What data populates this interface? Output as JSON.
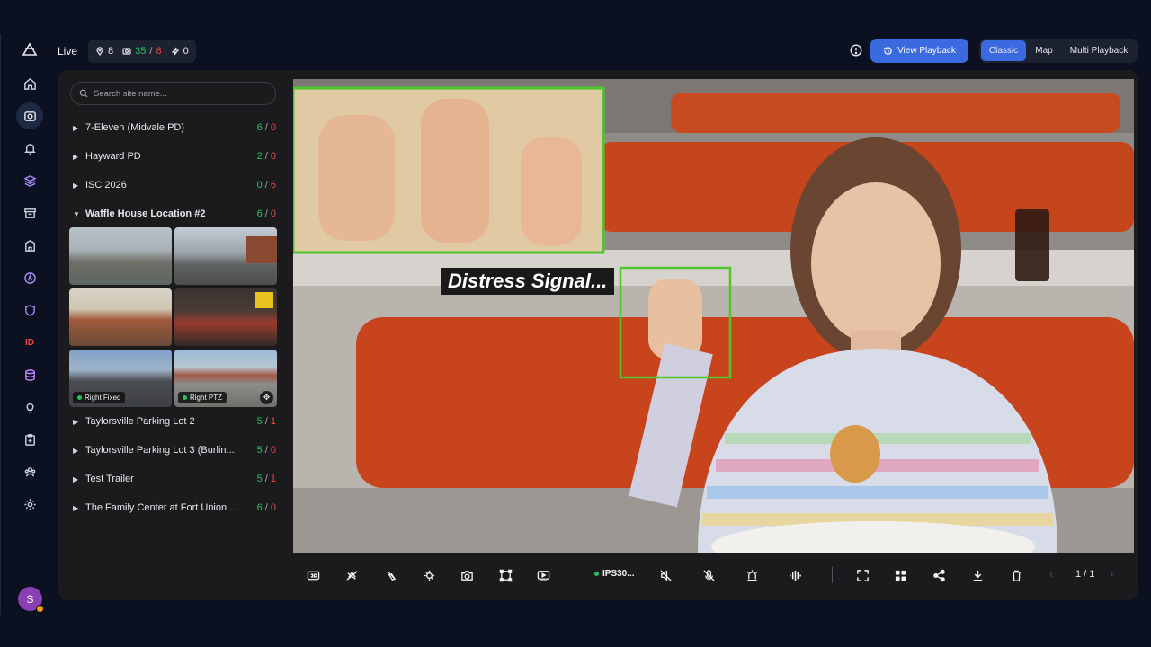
{
  "topbar": {
    "live_label": "Live",
    "stats": {
      "locations": "8",
      "online": "35",
      "offline": "8",
      "alerts": "0"
    },
    "view_playback": "View Playback",
    "modes": [
      "Classic",
      "Map",
      "Multi Playback"
    ],
    "active_mode": "Classic"
  },
  "rail": {
    "items": [
      "home-icon",
      "camera-icon",
      "bell-icon",
      "layers-icon",
      "archive-icon",
      "building-icon",
      "compass-icon",
      "shield-icon",
      "id-icon",
      "database-icon",
      "lightbulb-icon",
      "clipboard-icon",
      "users-icon",
      "gear-icon"
    ],
    "id_text": "ID",
    "avatar_initial": "S"
  },
  "sidebar": {
    "search_placeholder": "Search site name...",
    "sites": [
      {
        "name": "7-Eleven (Midvale PD)",
        "online": "6",
        "offline": "0",
        "expanded": false
      },
      {
        "name": "Hayward PD",
        "online": "2",
        "offline": "0",
        "expanded": false
      },
      {
        "name": "ISC 2026",
        "online": "0",
        "offline": "6",
        "expanded": false
      },
      {
        "name": "Waffle House Location #2",
        "online": "6",
        "offline": "0",
        "expanded": true
      },
      {
        "name": "Taylorsville Parking Lot 2",
        "online": "5",
        "offline": "1",
        "expanded": false
      },
      {
        "name": "Taylorsville Parking Lot 3 (Burlin...",
        "online": "5",
        "offline": "0",
        "expanded": false
      },
      {
        "name": "Test Trailer",
        "online": "5",
        "offline": "1",
        "expanded": false
      },
      {
        "name": "The Family Center at Fort Union ...",
        "online": "6",
        "offline": "0",
        "expanded": false
      }
    ],
    "cameras": [
      {
        "label": ""
      },
      {
        "label": ""
      },
      {
        "label": ""
      },
      {
        "label": ""
      },
      {
        "label": "Right Fixed"
      },
      {
        "label": "Right PTZ"
      }
    ]
  },
  "main": {
    "overlay_text": "Distress Signal...",
    "camera_name": "IPS30...",
    "page_indicator": "1 / 1"
  },
  "colors": {
    "accent": "#3b6ae0",
    "online": "#22c55e",
    "offline": "#ef4444",
    "detection_box": "#4fc72a"
  }
}
